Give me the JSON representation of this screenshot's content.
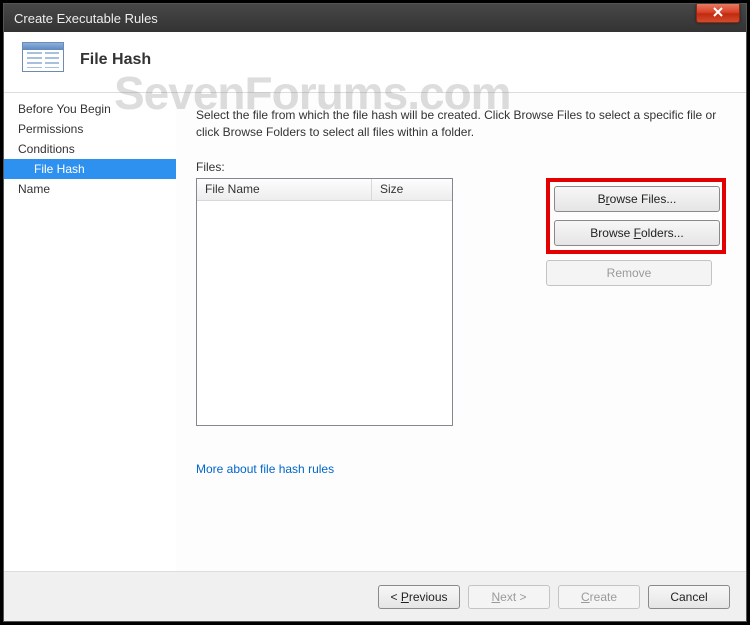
{
  "window": {
    "title": "Create Executable Rules"
  },
  "header": {
    "title": "File Hash"
  },
  "sidebar": {
    "items": [
      {
        "label": "Before You Begin",
        "selected": false,
        "indent": false
      },
      {
        "label": "Permissions",
        "selected": false,
        "indent": false
      },
      {
        "label": "Conditions",
        "selected": false,
        "indent": false
      },
      {
        "label": "File Hash",
        "selected": true,
        "indent": true
      },
      {
        "label": "Name",
        "selected": false,
        "indent": false
      }
    ]
  },
  "main": {
    "instructions": "Select the file from which the file hash will be created. Click Browse Files to select a specific file or click Browse Folders to select all files within a folder.",
    "files_label": "Files:",
    "columns": {
      "c1": "File Name",
      "c2": "Size"
    },
    "buttons": {
      "browse_files_pre": "B",
      "browse_files_key": "r",
      "browse_files_post": "owse Files...",
      "browse_folders_pre": "Browse ",
      "browse_folders_key": "F",
      "browse_folders_post": "olders...",
      "remove": "Remove"
    },
    "more_link": "More about file hash rules"
  },
  "footer": {
    "prev_pre": "< ",
    "prev_key": "P",
    "prev_post": "revious",
    "next_pre": "",
    "next_key": "N",
    "next_post": "ext >",
    "create_pre": "",
    "create_key": "C",
    "create_post": "reate",
    "cancel": "Cancel"
  },
  "watermark": "SevenForums.com"
}
